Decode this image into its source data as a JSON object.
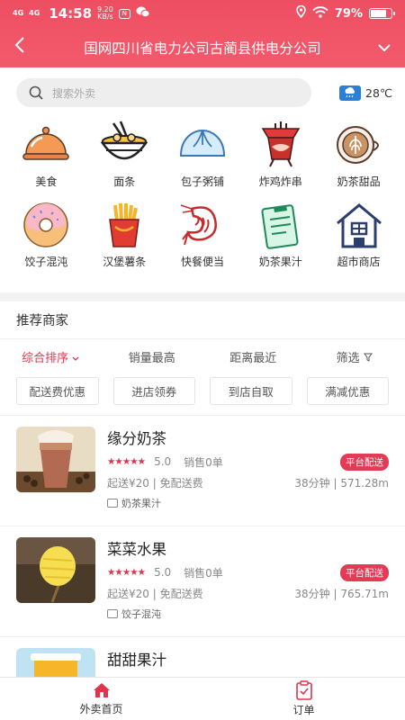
{
  "status_bar": {
    "signal1": "4G",
    "signal2": "4G",
    "time": "14:58",
    "speed_value": "9.20",
    "speed_unit": "KB/s",
    "mini_icon": "N",
    "battery": "79%",
    "battery_level": 0.79
  },
  "header": {
    "title": "国网四川省电力公司古蔺县供电分公司",
    "back_icon": "chevron-left-icon",
    "dropdown_icon": "chevron-down-icon"
  },
  "search": {
    "placeholder": "搜索外卖",
    "weather_temp": "28℃"
  },
  "categories": [
    {
      "label": "美食",
      "icon": "cloche-icon"
    },
    {
      "label": "面条",
      "icon": "noodle-bowl-icon"
    },
    {
      "label": "包子粥铺",
      "icon": "bun-icon"
    },
    {
      "label": "炸鸡炸串",
      "icon": "fried-chicken-icon"
    },
    {
      "label": "奶茶甜品",
      "icon": "latte-icon"
    },
    {
      "label": "饺子混沌",
      "icon": "donut-icon"
    },
    {
      "label": "汉堡薯条",
      "icon": "fries-icon"
    },
    {
      "label": "快餐便当",
      "icon": "shrimp-icon"
    },
    {
      "label": "奶茶果汁",
      "icon": "clipboard-icon"
    },
    {
      "label": "超市商店",
      "icon": "house-icon"
    }
  ],
  "recommend": {
    "title": "推荐商家",
    "sorts": [
      {
        "label": "综合排序"
      },
      {
        "label": "销量最高"
      },
      {
        "label": "距离最近"
      },
      {
        "label": "筛选"
      }
    ],
    "filters": [
      "配送费优惠",
      "进店领券",
      "到店自取",
      "满减优惠"
    ]
  },
  "shops": [
    {
      "name": "缘分奶茶",
      "stars": "★★★★★",
      "score": "5.0",
      "sales": "销售0单",
      "badge": "平台配送",
      "price": "起送¥20 | 免配送费",
      "distance": "38分钟 | 571.28m",
      "tag": "奶茶果汁"
    },
    {
      "name": "菜菜水果",
      "stars": "★★★★★",
      "score": "5.0",
      "sales": "销售0单",
      "badge": "平台配送",
      "price": "起送¥20 | 免配送费",
      "distance": "38分钟 | 765.71m",
      "tag": "饺子混沌"
    },
    {
      "name": "甜甜果汁"
    }
  ],
  "bottom_nav": {
    "home": "外卖首页",
    "orders": "订单"
  },
  "colors": {
    "brand_red": "#e0344d",
    "header_gradient_top": "#ee4e62",
    "header_gradient_bottom": "#f25a6c"
  }
}
